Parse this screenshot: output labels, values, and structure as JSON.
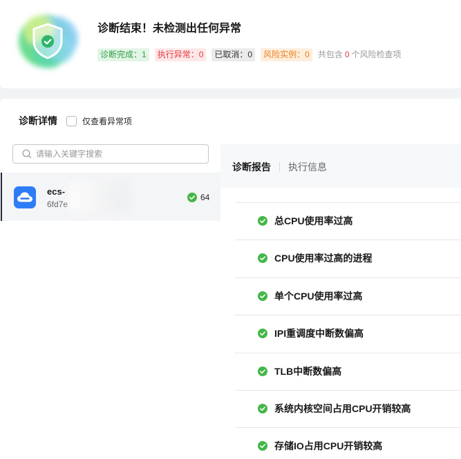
{
  "header": {
    "title": "诊断结束！未检测出任何异常",
    "status_icon": "shield-check-icon",
    "badges": {
      "completed": {
        "label": "诊断完成：",
        "count": "1"
      },
      "failed": {
        "label": "执行异常：",
        "count": "0"
      },
      "cancelled": {
        "label": "已取消：",
        "count": "0"
      },
      "risk_instances": {
        "label": "风险实例：",
        "count": "0"
      }
    },
    "risk_summary": {
      "prefix": "共包含",
      "count": "0",
      "suffix": "个风险检查项"
    }
  },
  "details": {
    "title": "诊断详情",
    "filter": {
      "label": "仅查看异常项",
      "checked": false
    },
    "search": {
      "placeholder": "请输入关键字搜索",
      "value": "",
      "icon": "search-icon"
    },
    "instances": [
      {
        "name": "ecs-",
        "id": "6fd7e",
        "icon": "cloud-server-icon",
        "status_icon": "check-circle-icon",
        "passed_count": "64",
        "selected": true
      }
    ]
  },
  "report": {
    "tabs": [
      {
        "label": "诊断报告",
        "active": true
      },
      {
        "label": "执行信息",
        "active": false
      }
    ],
    "items": [
      {
        "label": "总CPU使用率过高",
        "icon": "check-circle-icon"
      },
      {
        "label": "CPU使用率过高的进程",
        "icon": "check-circle-icon"
      },
      {
        "label": "单个CPU使用率过高",
        "icon": "check-circle-icon"
      },
      {
        "label": "IPI重调度中断数偏高",
        "icon": "check-circle-icon"
      },
      {
        "label": "TLB中断数偏高",
        "icon": "check-circle-icon"
      },
      {
        "label": "系统内核空间占用CPU开销较高",
        "icon": "check-circle-icon"
      },
      {
        "label": "存储IO占用CPU开销较高",
        "icon": "check-circle-icon"
      }
    ]
  },
  "colors": {
    "success": "#45b649",
    "success_badge_bg": "#e3f5e6",
    "success_badge_text": "#2f9e44",
    "danger_badge_bg": "#fde8e8",
    "danger_badge_text": "#e5393e",
    "neutral_badge_bg": "#ebebeb",
    "neutral_badge_text": "#333333",
    "warning_badge_bg": "#fdeedc",
    "warning_badge_text": "#e9811d",
    "risk_count": "#e5393e",
    "instance_icon_bg": "#2e7cf6",
    "selected_indicator": "#252b3a"
  }
}
